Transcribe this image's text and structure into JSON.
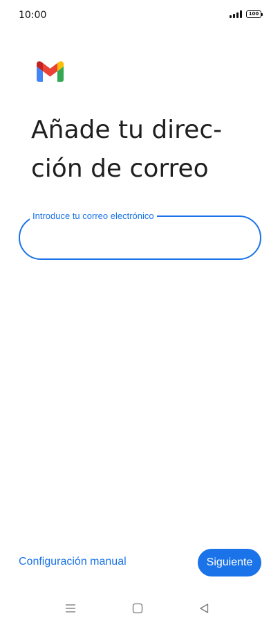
{
  "status_bar": {
    "time": "10:00",
    "battery": "100",
    "icons": [
      "signal-icon",
      "battery-icon"
    ]
  },
  "app": {
    "logo": "gmail-logo",
    "brand_colors": {
      "red": "#ea4335",
      "blue": "#4285f4",
      "green": "#34a853",
      "yellow": "#fbbc04",
      "dark_red": "#c5221f"
    }
  },
  "main": {
    "title_line_1": "Añade tu direc-",
    "title_line_2": "ción de correo",
    "email_field": {
      "label": "Introduce tu correo electrónico",
      "value": ""
    }
  },
  "footer": {
    "manual_config_label": "Configuración manual",
    "next_label": "Siguiente"
  },
  "nav_bar": {
    "icons": [
      "menu-icon",
      "home-icon",
      "back-icon"
    ]
  },
  "colors": {
    "accent": "#1a73e8",
    "text": "#1f1f1f",
    "background": "#ffffff"
  }
}
